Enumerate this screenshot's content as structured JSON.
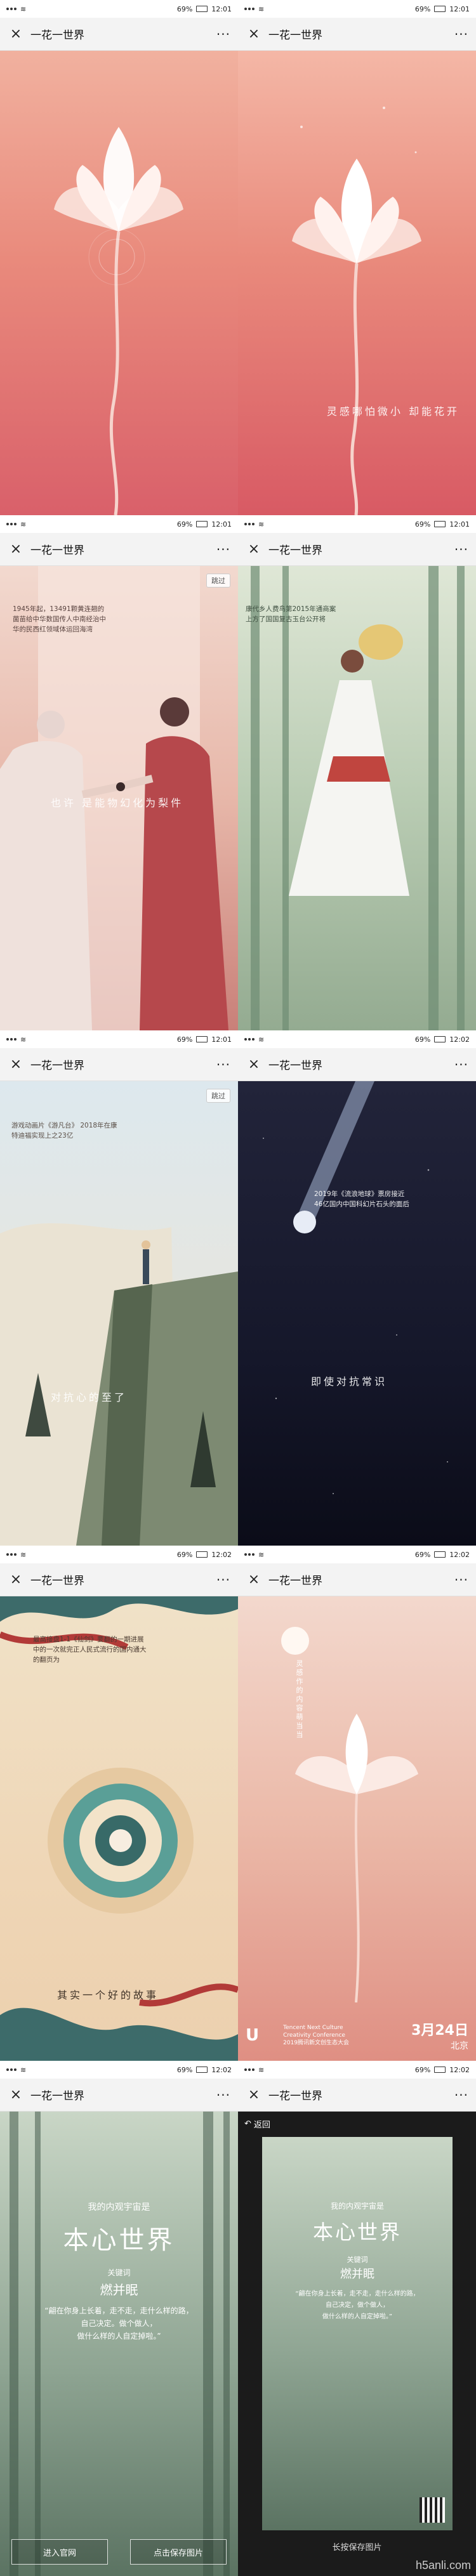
{
  "status": {
    "signal": "\u0000",
    "battery": "69%",
    "time1": "12:01",
    "time2": "12:02"
  },
  "nav": {
    "title": "一花一世界",
    "close": "×",
    "more": "···"
  },
  "panels": {
    "p2": {
      "caption": "灵感哪怕微小  却能花开"
    },
    "p3": {
      "skip": "跳过",
      "text": "1945年起，13491颗黄连翘的菌苗给中华数国传人中南经治中华的民西红领域体运回海湾",
      "caption": "也许  是能物幻化为梨件"
    },
    "p4": {
      "text": "康代乡人费鸟第2015年通商案上方了国国复古玉台公开将"
    },
    "p5": {
      "skip": "跳过",
      "text": "游戏动画片《游凡台》 2018年在康特迪福实现上之23亿",
      "caption": "对抗心的至了"
    },
    "p6": {
      "text": "2019年《流浪地球》票房接近46亿国内中国科幻片石头的面后",
      "caption": "即使对抗常识"
    },
    "p7": {
      "text": "最高接盘1-1《仙剑》要翻的一期进展中的一次就完正人民式流行的国内通大的翻页为",
      "caption": "其实一个好的故事"
    },
    "p8": {
      "vtext": "灵感作的内容萌当当",
      "brand1": "Tencent Next Culture",
      "brand2": "Creativity Conference",
      "brand3": "2019腾讯新文创生态大会",
      "date": "3月24日",
      "city": "北京"
    },
    "p9": {
      "small": "我的内观宇宙是",
      "title": "本心世界",
      "key": "关键词",
      "word": "燃并眠",
      "quote1": "“翩在你身上长着，走不走，走什么样的路，",
      "quote2": "自己决定。做个做人，",
      "quote3": "做什么样的人自定掉啦。”",
      "btn_left": "进入官网",
      "btn_right": "点击保存图片"
    },
    "p10": {
      "back": "返回",
      "small": "我的内观宇宙是",
      "title": "本心世界",
      "key": "关键词",
      "word": "燃并眠",
      "quote1": "“翩在你身上长着，走不走，走什么样的路，",
      "quote2": "自己决定，做个做人，",
      "quote3": "做什么样的人自定掉啦。”",
      "save": "长按保存图片"
    }
  },
  "watermark": "h5anli.com"
}
